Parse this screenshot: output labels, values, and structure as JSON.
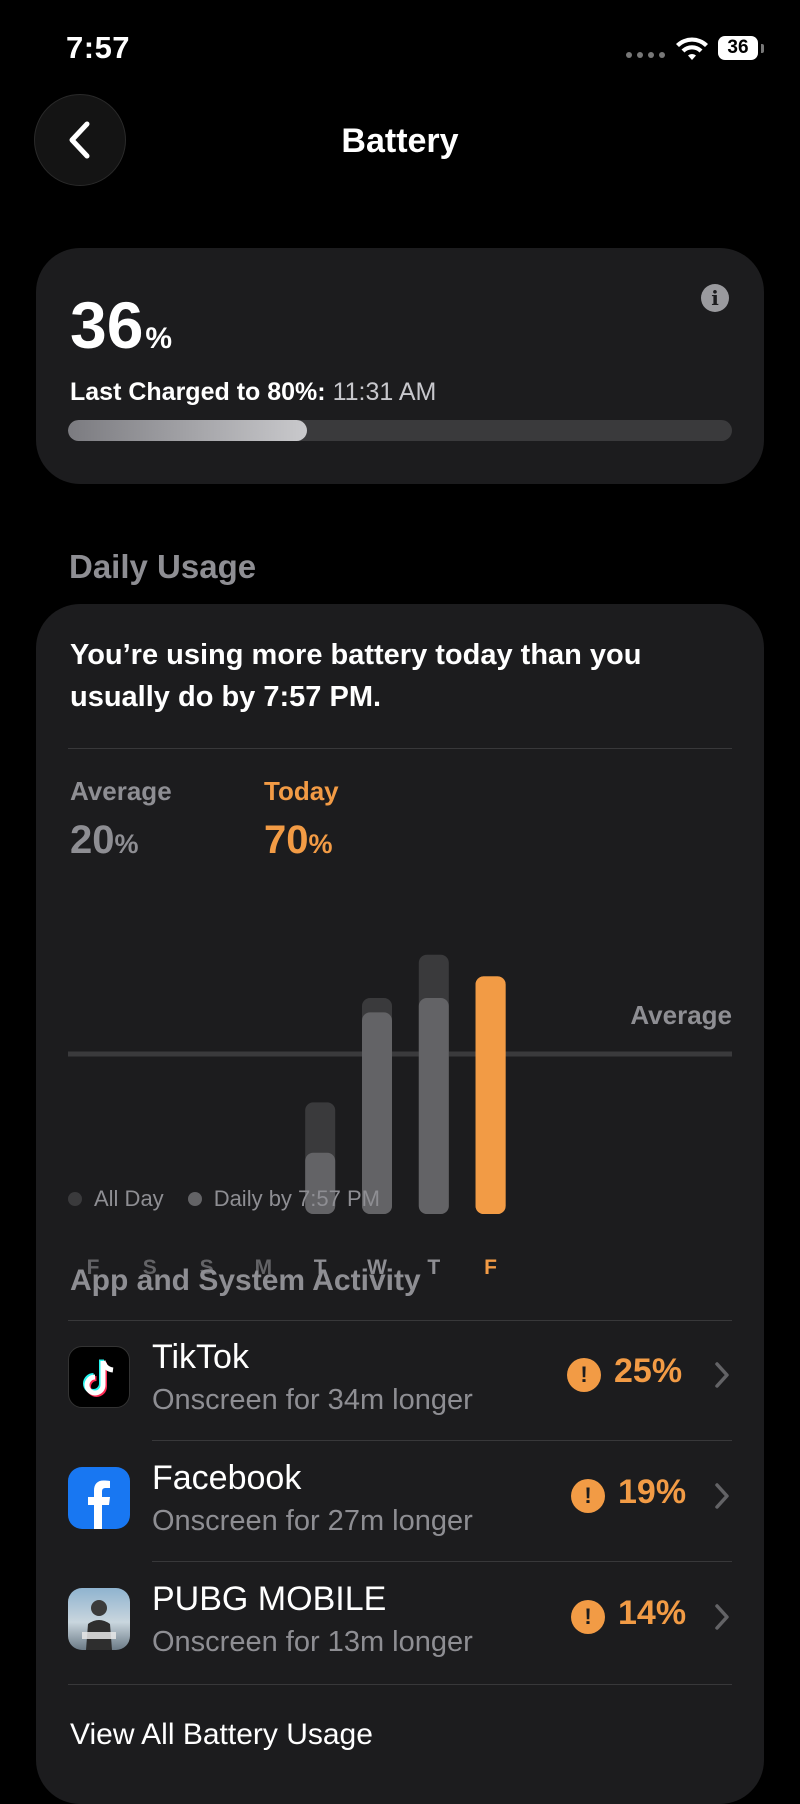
{
  "status_bar": {
    "time": "7:57",
    "battery_level": "36"
  },
  "nav": {
    "title": "Battery",
    "back_icon": "chevron-left-icon"
  },
  "battery": {
    "percent": "36",
    "percent_sign": "%",
    "last_charged_label": "Last Charged to 80%:",
    "last_charged_time": "11:31 AM",
    "level_fraction": 0.36
  },
  "daily_usage": {
    "section_title": "Daily Usage",
    "message": "You’re using more battery today than you usually do by 7:57 PM.",
    "average": {
      "label": "Average",
      "value": "20",
      "sign": "%"
    },
    "today": {
      "label": "Today",
      "value": "70",
      "sign": "%"
    },
    "avg_line_label": "Average",
    "colors": {
      "average": "#8e8e93",
      "today": "#f29b45",
      "bar_dim": "#3a3a3c",
      "bar_bright": "#636366"
    },
    "chart_data": {
      "type": "bar",
      "categories": [
        "F",
        "S",
        "S",
        "M",
        "T",
        "W",
        "T",
        "F"
      ],
      "series": [
        {
          "name": "All Day",
          "values": [
            0,
            0,
            0,
            0,
            31,
            60,
            72,
            66
          ]
        },
        {
          "name": "Daily by 7:57 PM",
          "values": [
            0,
            0,
            0,
            0,
            17,
            56,
            60,
            66
          ]
        }
      ],
      "average_line": 20,
      "highlight_index": 7
    },
    "legend": {
      "all_day": "All Day",
      "daily_by": "Daily by 7:57 PM"
    }
  },
  "activity": {
    "header": "App and System Activity",
    "apps": [
      {
        "name": "TikTok",
        "sub": "Onscreen for 34m longer",
        "pct": "25%",
        "icon": "tiktok-icon"
      },
      {
        "name": "Facebook",
        "sub": "Onscreen for 27m longer",
        "pct": "19%",
        "icon": "facebook-icon"
      },
      {
        "name": "PUBG MOBILE",
        "sub": "Onscreen for 13m longer",
        "pct": "14%",
        "icon": "pubg-icon"
      }
    ],
    "view_all": "View All Battery Usage"
  }
}
